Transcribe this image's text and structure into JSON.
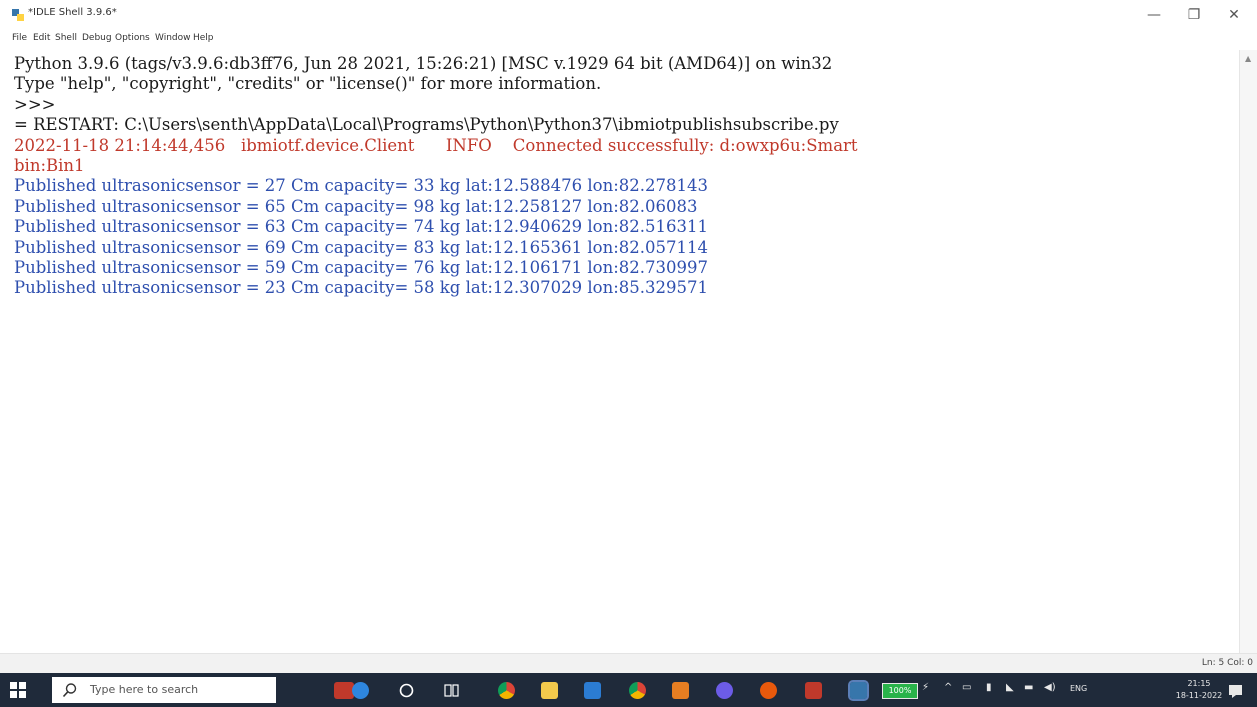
{
  "window": {
    "title": "*IDLE Shell 3.9.6*",
    "controls": {
      "minimize": "—",
      "maximize": "❐",
      "close": "✕"
    }
  },
  "menu": [
    "File",
    "Edit",
    "Shell",
    "Debug",
    "Options",
    "Window",
    "Help"
  ],
  "shell": {
    "lines": [
      {
        "text": "Python 3.9.6 (tags/v3.9.6:db3ff76, Jun 28 2021, 15:26:21) [MSC v.1929 64 bit (AMD64)] on win32",
        "color": "black"
      },
      {
        "text": "Type \"help\", \"copyright\", \"credits\" or \"license()\" for more information.",
        "color": "black"
      },
      {
        "text": ">>> ",
        "color": "black"
      },
      {
        "text": "= RESTART: C:\\Users\\senth\\AppData\\Local\\Programs\\Python\\Python37\\ibmiotpublishsubscribe.py",
        "color": "black"
      },
      {
        "text": "2022-11-18 21:14:44,456   ibmiotf.device.Client      INFO    Connected successfully: d:owxp6u:Smart",
        "color": "red"
      },
      {
        "text": "bin:Bin1",
        "color": "red"
      },
      {
        "text": "Published ultrasonicsensor = 27 Cm capacity= 33 kg lat:12.588476 lon:82.278143",
        "color": "blue"
      },
      {
        "text": "Published ultrasonicsensor = 65 Cm capacity= 98 kg lat:12.258127 lon:82.06083",
        "color": "blue"
      },
      {
        "text": "Published ultrasonicsensor = 63 Cm capacity= 74 kg lat:12.940629 lon:82.516311",
        "color": "blue"
      },
      {
        "text": "Published ultrasonicsensor = 69 Cm capacity= 83 kg lat:12.165361 lon:82.057114",
        "color": "blue"
      },
      {
        "text": "Published ultrasonicsensor = 59 Cm capacity= 76 kg lat:12.106171 lon:82.730997",
        "color": "blue"
      },
      {
        "text": "Published ultrasonicsensor = 23 Cm capacity= 58 kg lat:12.307029 lon:85.329571",
        "color": "blue"
      }
    ]
  },
  "status": {
    "position": "Ln: 5  Col: 0"
  },
  "taskbar": {
    "search_placeholder": "Type here to search",
    "battery": "100%",
    "language": "ENG",
    "time": "21:15",
    "date": "18-11-2022"
  },
  "colors": {
    "black": "#1a1a1a",
    "red": "#c0392b",
    "blue": "#2e4fae",
    "taskbar": "#1f2a3a"
  }
}
